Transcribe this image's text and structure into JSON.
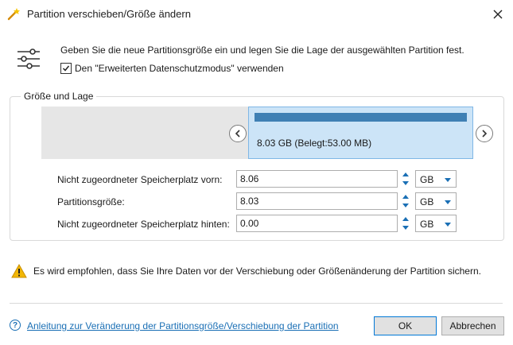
{
  "window": {
    "title": "Partition verschieben/Größe ändern"
  },
  "header": {
    "description": "Geben Sie die neue Partitionsgröße ein und legen Sie die Lage der ausgewählten Partition fest.",
    "checkbox_label": "Den \"Erweiterten Datenschutzmodus\" verwenden",
    "checkbox_checked": true
  },
  "group": {
    "title": "Größe und Lage",
    "partition_label": "8.03 GB (Belegt:53.00 MB)"
  },
  "fields": [
    {
      "label": "Nicht zugeordneter Speicherplatz vorn:",
      "value": "8.06",
      "unit": "GB"
    },
    {
      "label": "Partitionsgröße:",
      "value": "8.03",
      "unit": "GB"
    },
    {
      "label": "Nicht zugeordneter Speicherplatz hinten:",
      "value": "0.00",
      "unit": "GB"
    }
  ],
  "warning": "Es wird empfohlen, dass Sie Ihre Daten vor der Verschiebung oder Größenänderung der Partition sichern.",
  "footer": {
    "help_link": "Anleitung zur Veränderung der Partitionsgröße/Verschiebung der Partition",
    "ok_label": "OK",
    "cancel_label": "Abbrechen"
  },
  "colors": {
    "accent": "#1a6fb5",
    "partition_fill": "#cce4f7",
    "partition_border": "#7fb7e6",
    "used_bar": "#3f80b4",
    "warning": "#f2b705"
  }
}
